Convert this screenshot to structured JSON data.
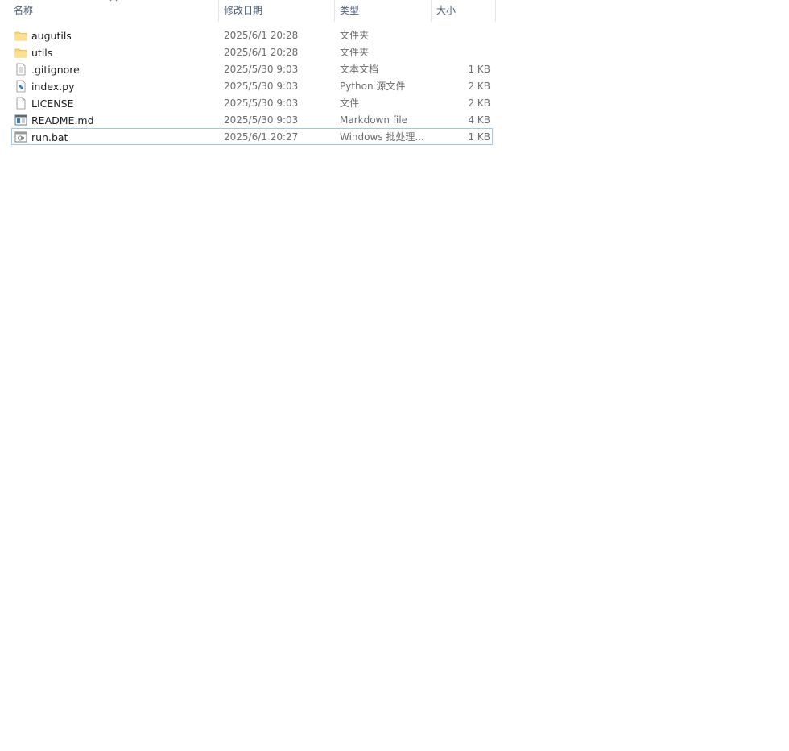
{
  "columns": {
    "name": "名称",
    "date": "修改日期",
    "type": "类型",
    "size": "大小"
  },
  "files": [
    {
      "name": "augutils",
      "date": "2025/6/1 20:28",
      "type": "文件夹",
      "size": "",
      "icon": "folder-icon"
    },
    {
      "name": "utils",
      "date": "2025/6/1 20:28",
      "type": "文件夹",
      "size": "",
      "icon": "folder-icon"
    },
    {
      "name": ".gitignore",
      "date": "2025/5/30 9:03",
      "type": "文本文档",
      "size": "1 KB",
      "icon": "text-file-icon"
    },
    {
      "name": "index.py",
      "date": "2025/5/30 9:03",
      "type": "Python 源文件",
      "size": "2 KB",
      "icon": "python-file-icon"
    },
    {
      "name": "LICENSE",
      "date": "2025/5/30 9:03",
      "type": "文件",
      "size": "2 KB",
      "icon": "blank-file-icon"
    },
    {
      "name": "README.md",
      "date": "2025/5/30 9:03",
      "type": "Markdown file",
      "size": "4 KB",
      "icon": "markdown-file-icon"
    },
    {
      "name": "run.bat",
      "date": "2025/6/1 20:27",
      "type": "Windows 批处理...",
      "size": "1 KB",
      "icon": "batch-file-icon"
    }
  ],
  "colors": {
    "header_text": "#4c607a",
    "selection_border": "#99c9ef",
    "folder": "#f8d775"
  }
}
